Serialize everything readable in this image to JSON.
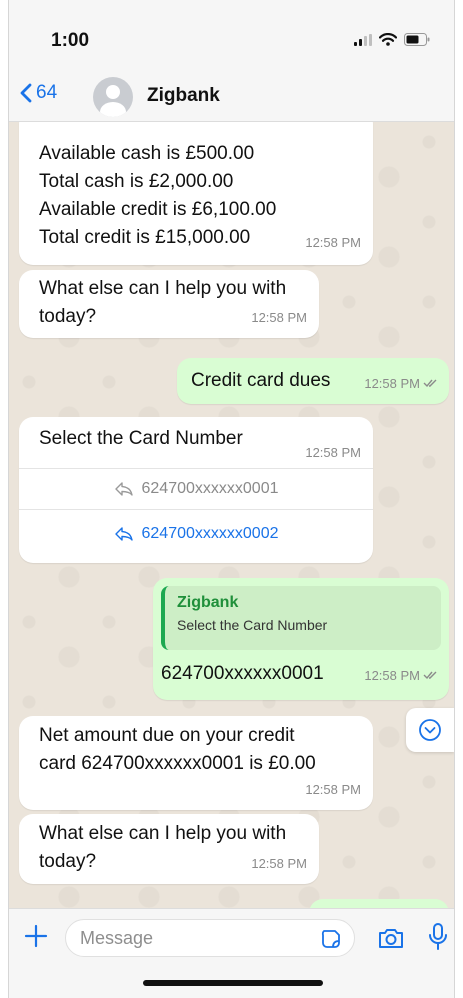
{
  "status_bar": {
    "time": "1:00",
    "icons": [
      "signal-icon",
      "wifi-icon",
      "battery-icon"
    ]
  },
  "header": {
    "back_count": "64",
    "contact_name": "Zigbank",
    "icons": [
      "chevron-left-icon",
      "avatar-icon"
    ]
  },
  "messages": [
    {
      "direction": "in",
      "lines": [
        "Available cash is £500.00",
        "Total cash is £2,000.00",
        "Available credit is £6,100.00",
        "Total credit is £15,000.00"
      ],
      "time": "12:58 PM"
    },
    {
      "direction": "in",
      "lines": [
        "What else can I help you with",
        "today?"
      ],
      "time": "12:58 PM"
    },
    {
      "direction": "out",
      "text": "Credit card dues",
      "time": "12:58 PM",
      "read": true
    },
    {
      "direction": "in",
      "text": "Select the Card Number",
      "time": "12:58 PM",
      "options": [
        "624700xxxxxx0001",
        "624700xxxxxx0002"
      ]
    },
    {
      "direction": "out",
      "quote": {
        "name": "Zigbank",
        "text": "Select the Card Number"
      },
      "text": "624700xxxxxx0001",
      "time": "12:58 PM",
      "read": true
    },
    {
      "direction": "in",
      "lines": [
        "Net amount due on your credit",
        "card 624700xxxxxx0001 is £0.00"
      ],
      "time": "12:58 PM"
    },
    {
      "direction": "in",
      "lines": [
        "What else can I help you with",
        "today?"
      ],
      "time": "12:58 PM"
    }
  ],
  "composer": {
    "placeholder": "Message",
    "icons": [
      "plus-icon",
      "sticker-icon",
      "camera-icon",
      "microphone-icon"
    ]
  },
  "colors": {
    "accent": "#1a73e8",
    "outgoing_bubble": "#d9fdd3",
    "incoming_bubble": "#ffffff",
    "chat_bg": "#ebe4da",
    "quote_name": "#1f8f3a"
  }
}
